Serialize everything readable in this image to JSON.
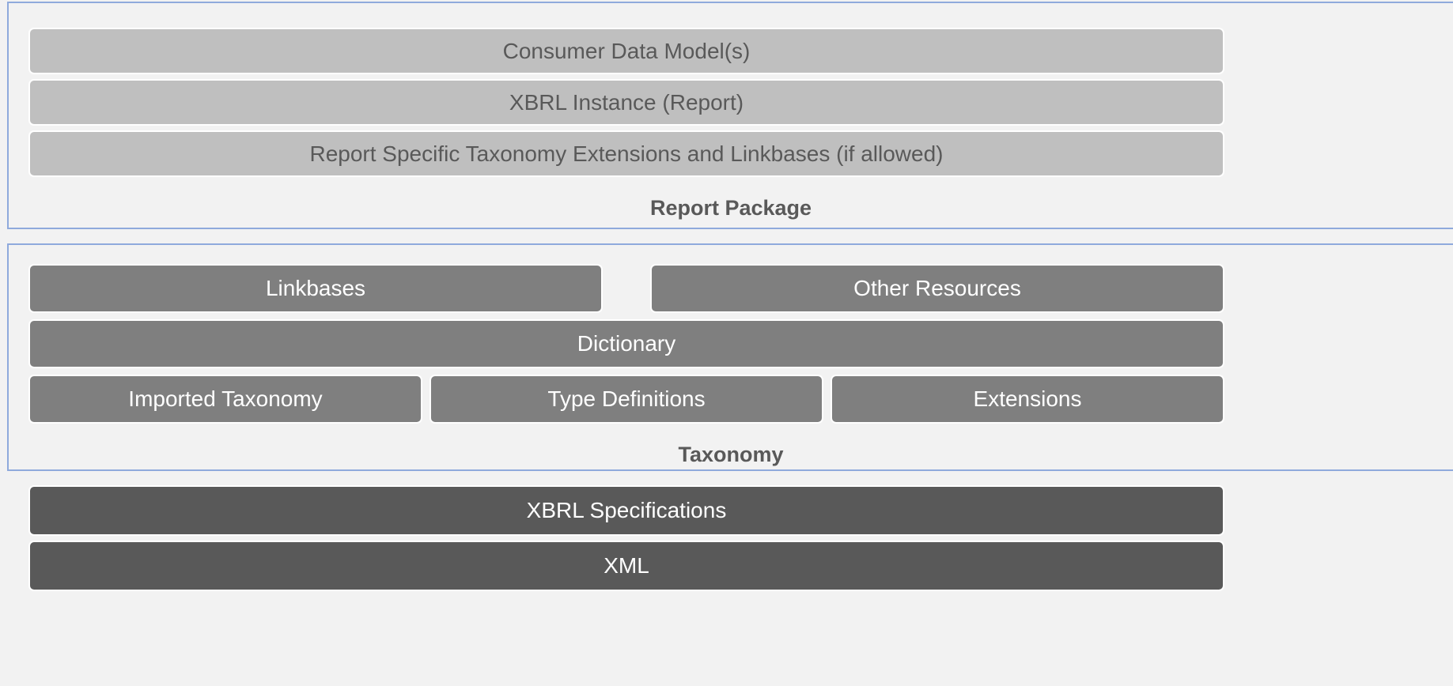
{
  "report_package": {
    "title": "Report Package",
    "layers": [
      "Consumer Data Model(s)",
      "XBRL Instance (Report)",
      "Report Specific Taxonomy Extensions and Linkbases (if allowed)"
    ]
  },
  "taxonomy": {
    "title": "Taxonomy",
    "top_left": "Linkbases",
    "top_right": "Other Resources",
    "middle": "Dictionary",
    "bottom": [
      "Imported Taxonomy",
      "Type Definitions",
      "Extensions"
    ]
  },
  "foundation": {
    "layers": [
      "XBRL Specifications",
      "XML"
    ]
  },
  "colors": {
    "frame_border": "#8faadc",
    "background": "#f2f2f2",
    "light_block": "#bfbfbf",
    "mid_block": "#7f7f7f",
    "dark_block": "#595959"
  }
}
